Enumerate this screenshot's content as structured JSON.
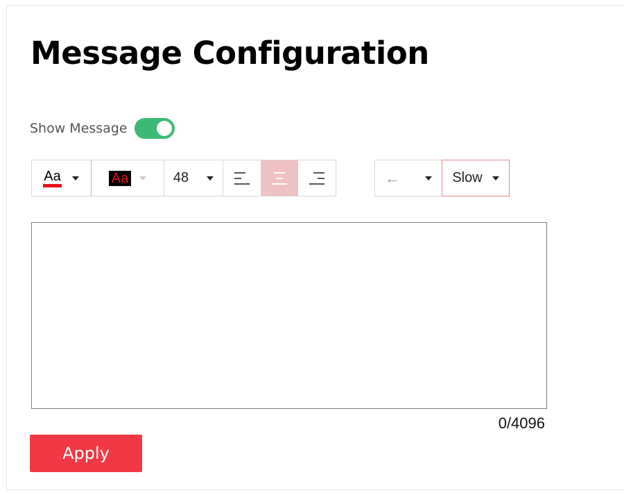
{
  "page": {
    "title": "Message Configuration"
  },
  "show_message": {
    "label": "Show Message",
    "enabled": true,
    "toggle_color": "#3cba75"
  },
  "toolbar": {
    "font_color": {
      "label": "Aa",
      "color": "#e8131b"
    },
    "background_color": {
      "label": "Aa",
      "background": "#000000",
      "text_color": "#e8131b"
    },
    "font_size": {
      "value": "48"
    },
    "alignment": {
      "options": [
        "left",
        "center",
        "right"
      ],
      "selected": "center"
    },
    "scroll_direction": {
      "icon": "arrow-left-icon",
      "glyph": "←"
    },
    "scroll_speed": {
      "value": "Slow"
    }
  },
  "message_input": {
    "value": "",
    "counter": "0/4096"
  },
  "apply_button": {
    "label": "Apply",
    "color": "#f23845"
  }
}
